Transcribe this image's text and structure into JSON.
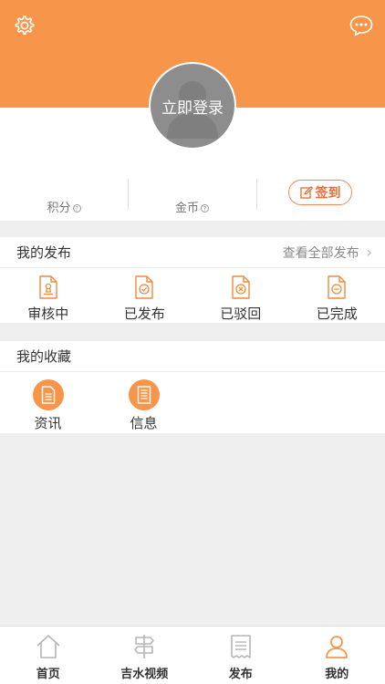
{
  "header": {
    "avatar_label": "立即登录",
    "settings_icon": "gear-icon",
    "chat_icon": "chat-bubble-icon"
  },
  "stats": {
    "points_label": "积分",
    "coins_label": "金币",
    "checkin_label": "签到"
  },
  "my_posts": {
    "title": "我的发布",
    "view_all": "查看全部发布",
    "items": [
      {
        "label": "审核中",
        "icon": "reviewing-doc-icon"
      },
      {
        "label": "已发布",
        "icon": "published-doc-icon"
      },
      {
        "label": "已驳回",
        "icon": "rejected-doc-icon"
      },
      {
        "label": "已完成",
        "icon": "completed-doc-icon"
      }
    ]
  },
  "favorites": {
    "title": "我的收藏",
    "items": [
      {
        "label": "资讯",
        "icon": "news-doc-icon"
      },
      {
        "label": "信息",
        "icon": "info-doc-icon"
      }
    ]
  },
  "tabbar": {
    "items": [
      {
        "label": "首页",
        "icon": "home-icon"
      },
      {
        "label": "吉水视频",
        "icon": "signpost-icon"
      },
      {
        "label": "发布",
        "icon": "receipt-icon"
      },
      {
        "label": "我的",
        "icon": "user-icon",
        "active": true
      }
    ]
  },
  "colors": {
    "accent": "#f7964a",
    "checkin": "#ee6b34",
    "background": "#efefef"
  }
}
